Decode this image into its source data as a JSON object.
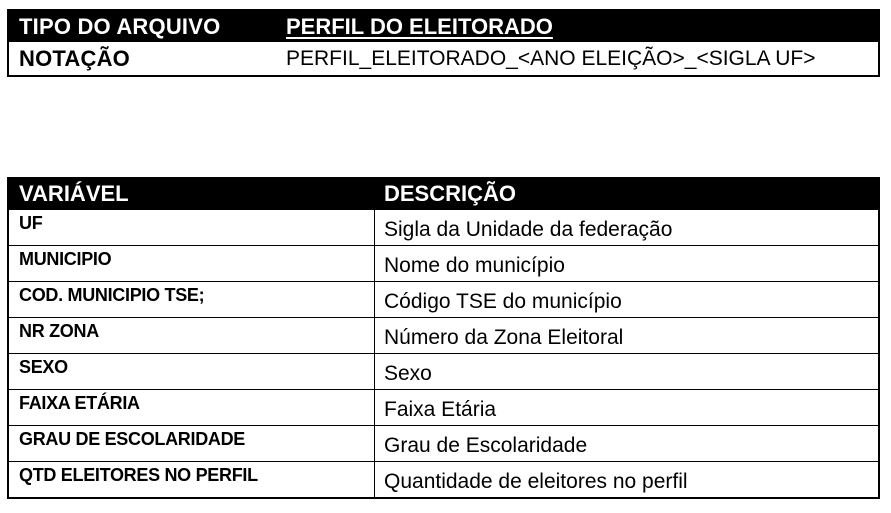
{
  "file_info": {
    "type_label": "TIPO DO ARQUIVO",
    "type_value": "PERFIL DO ELEITORADO",
    "notation_label": "NOTAÇÃO",
    "notation_value": "PERFIL_ELEITORADO_<ANO ELEIÇÃO>_<SIGLA UF>"
  },
  "variables": {
    "headers": {
      "variable": "VARIÁVEL",
      "description": "DESCRIÇÃO"
    },
    "rows": [
      {
        "variable": "UF",
        "description": "Sigla da Unidade da federação"
      },
      {
        "variable": "MUNICIPIO",
        "description": "Nome do município"
      },
      {
        "variable": "COD. MUNICIPIO TSE;",
        "description": "Código TSE do município"
      },
      {
        "variable": "NR ZONA",
        "description": "Número da Zona Eleitoral"
      },
      {
        "variable": "SEXO",
        "description": "Sexo"
      },
      {
        "variable": "FAIXA ETÁRIA",
        "description": "Faixa Etária"
      },
      {
        "variable": "GRAU DE ESCOLARIDADE",
        "description": "Grau de Escolaridade"
      },
      {
        "variable": "QTD ELEITORES NO PERFIL",
        "description": "Quantidade de eleitores no perfil"
      }
    ]
  }
}
